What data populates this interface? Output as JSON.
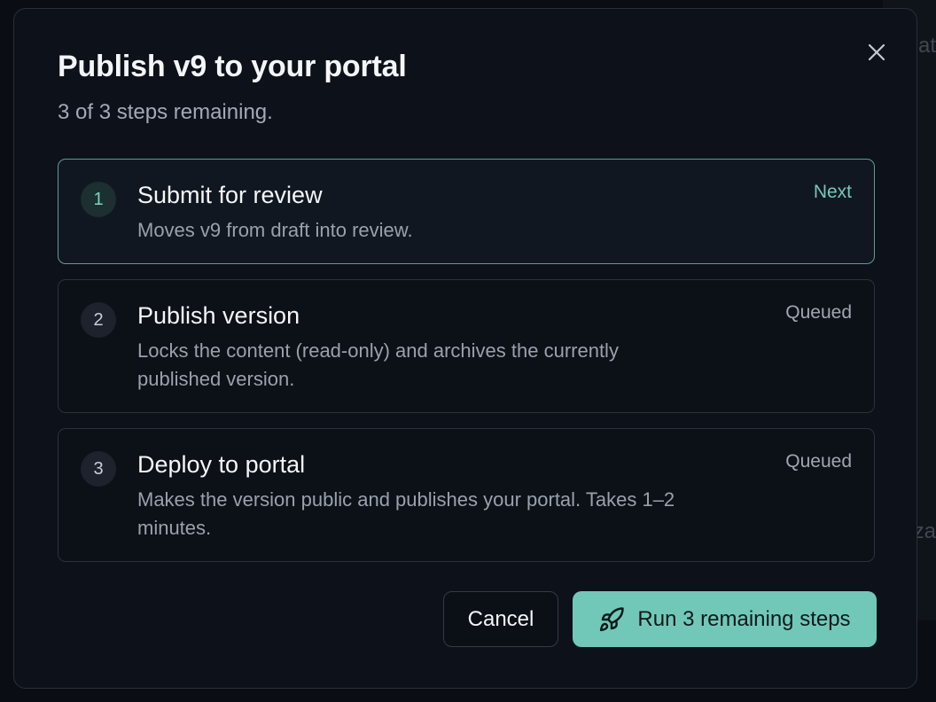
{
  "background": {
    "fragment_top": "at",
    "fragment_bottom": "za"
  },
  "modal": {
    "title": "Publish v9 to your portal",
    "subtitle": "3 of 3 steps remaining.",
    "close_icon": "close-icon",
    "steps": [
      {
        "number": "1",
        "title": "Submit for review",
        "description": "Moves v9 from draft into review.",
        "status": "Next",
        "active": true
      },
      {
        "number": "2",
        "title": "Publish version",
        "description": "Locks the content (read-only) and archives the currently published version.",
        "status": "Queued",
        "active": false
      },
      {
        "number": "3",
        "title": "Deploy to portal",
        "description": "Makes the version public and publishes your portal. Takes 1–2 minutes.",
        "status": "Queued",
        "active": false
      }
    ],
    "actions": {
      "cancel_label": "Cancel",
      "run_label": "Run 3 remaining steps",
      "run_icon": "rocket-icon"
    }
  },
  "colors": {
    "accent": "#72c8b8",
    "accent_text": "#74c9b8",
    "active_border": "#5f9c92",
    "modal_bg": "#0d1119"
  }
}
